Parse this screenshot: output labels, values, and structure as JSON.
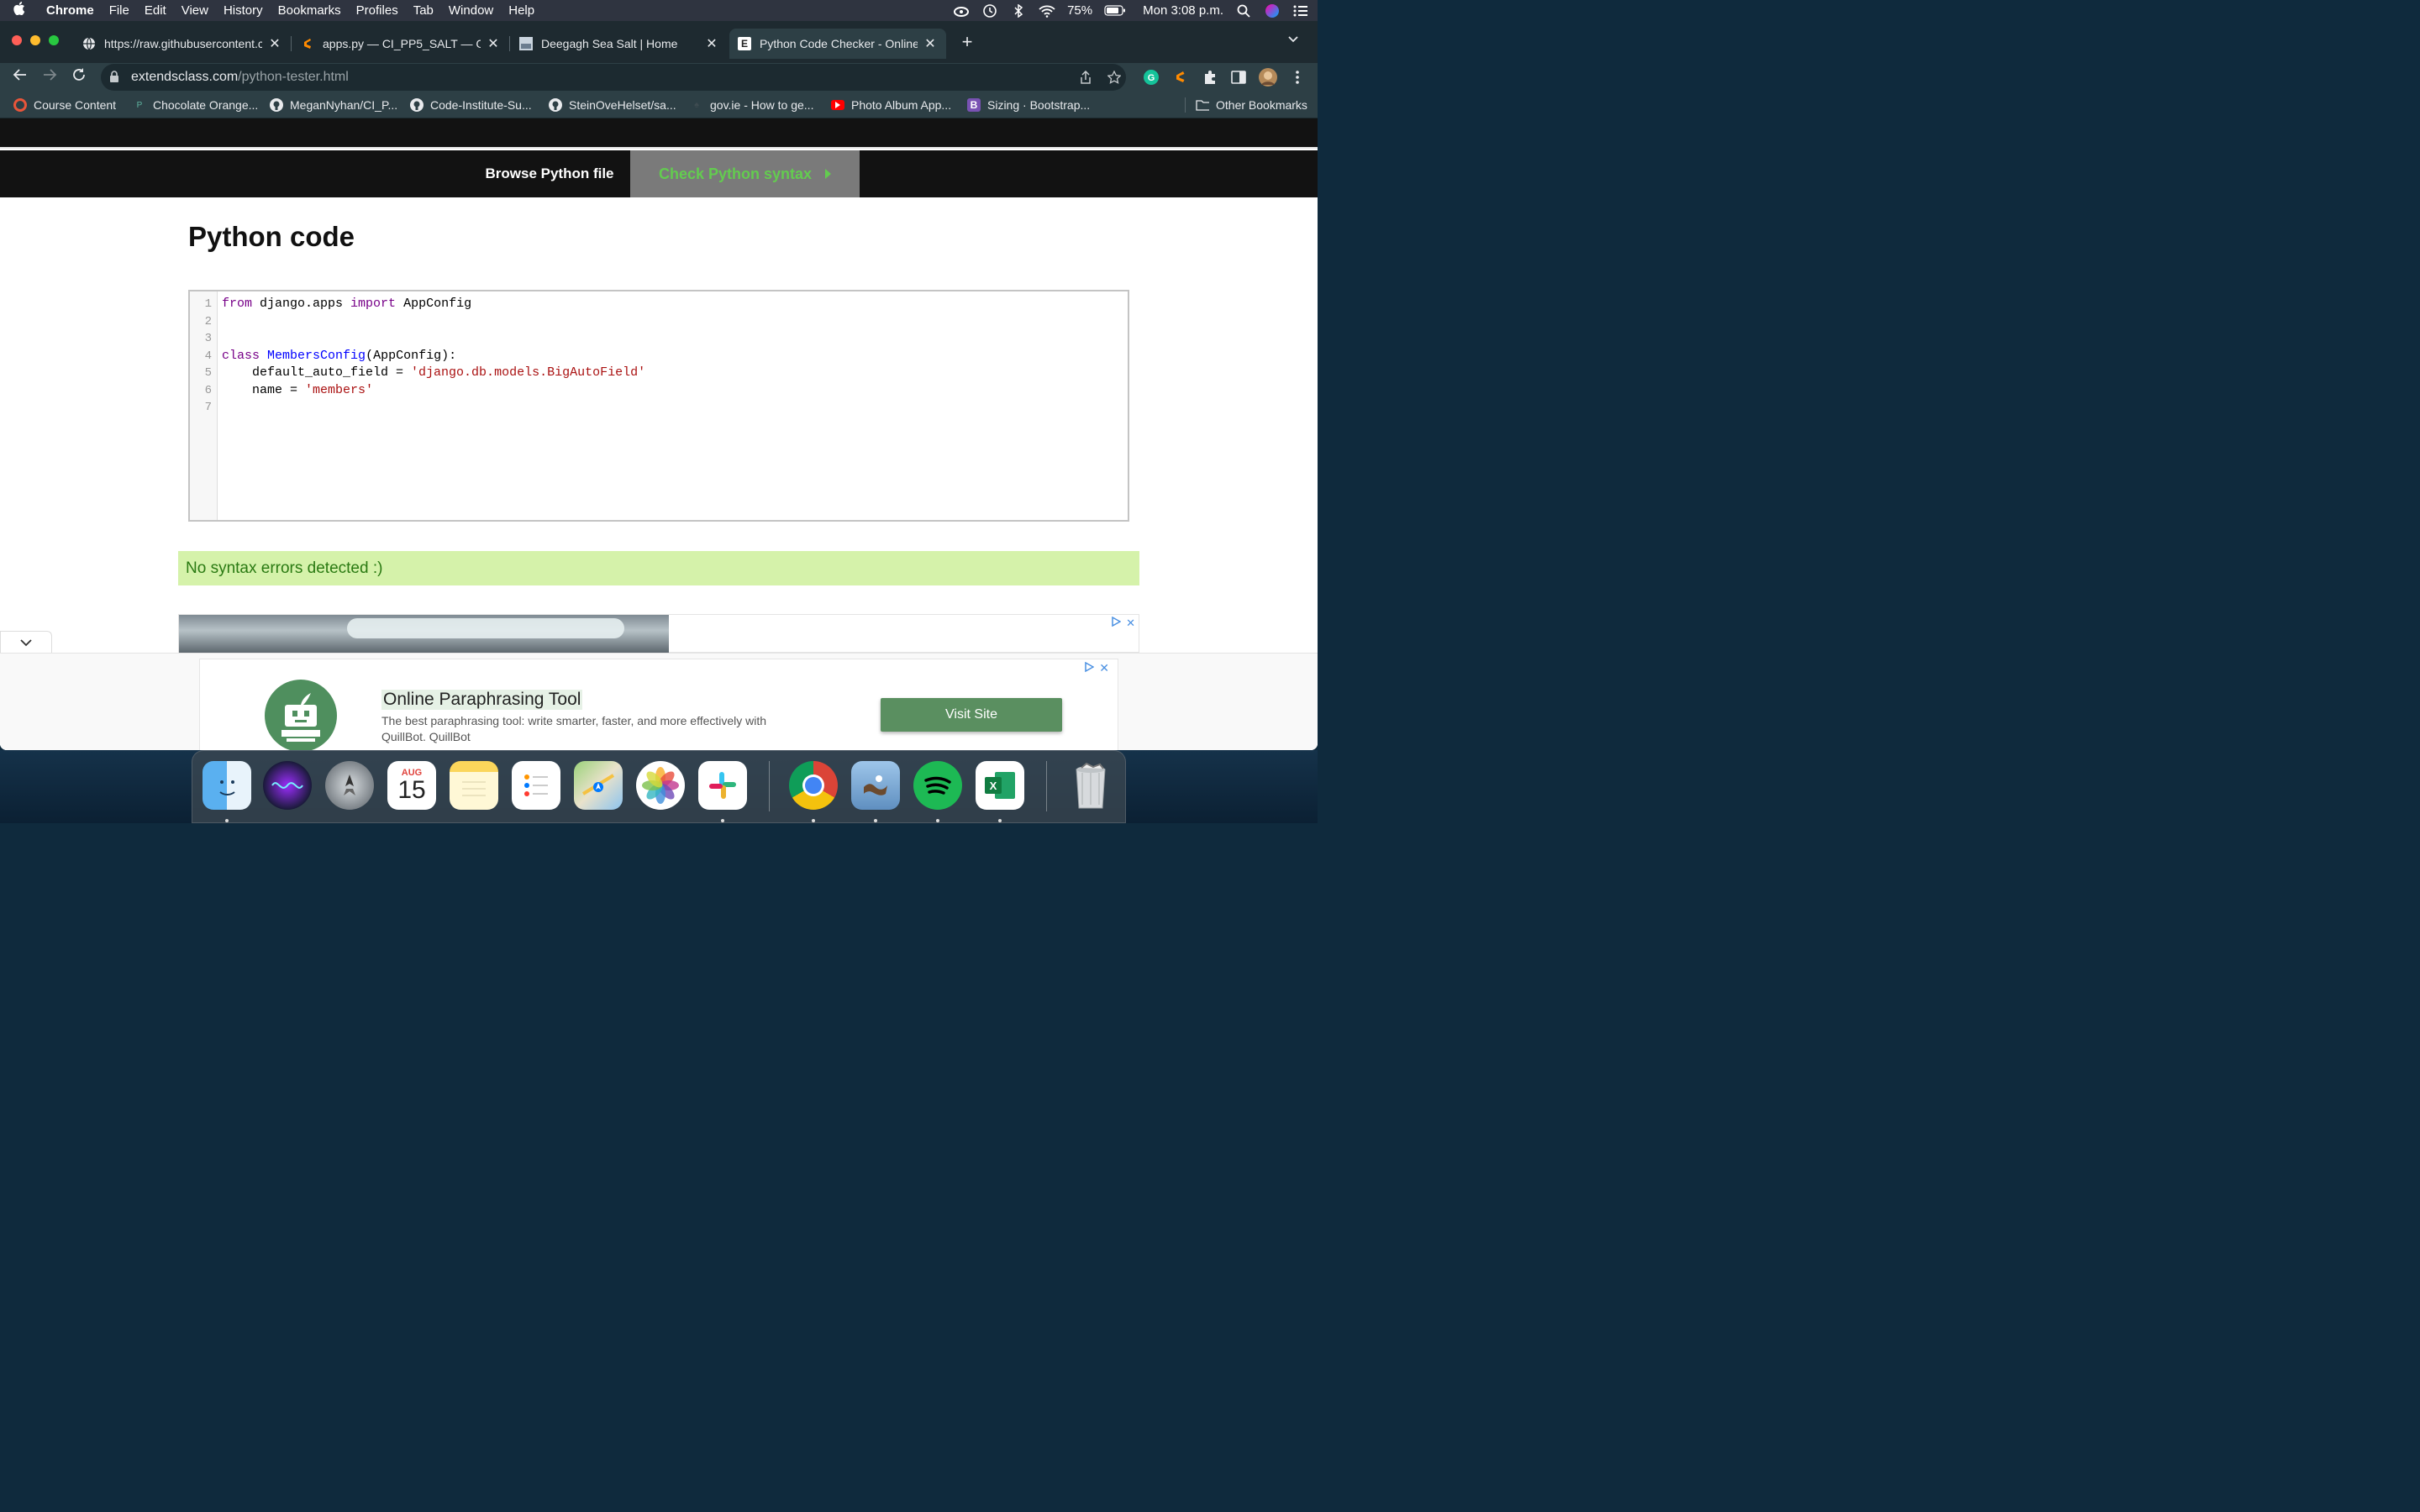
{
  "menubar": {
    "apple": "",
    "items": [
      "Chrome",
      "File",
      "Edit",
      "View",
      "History",
      "Bookmarks",
      "Profiles",
      "Tab",
      "Window",
      "Help"
    ],
    "battery": "75%",
    "clock": "Mon 3:08 p.m."
  },
  "tabs": [
    {
      "title": "https://raw.githubusercontent.c",
      "close": "✕"
    },
    {
      "title": "apps.py — CI_PP5_SALT — Git",
      "close": "✕"
    },
    {
      "title": "Deegagh Sea Salt | Home",
      "close": "✕"
    },
    {
      "title": "Python Code Checker - Online",
      "close": "✕",
      "favicon": "E"
    }
  ],
  "address": {
    "domain": "extendsclass.com",
    "path": "/python-tester.html"
  },
  "bookmarks": [
    "Course Content",
    "Chocolate Orange...",
    "MeganNyhan/CI_P...",
    "Code-Institute-Su...",
    "SteinOveHelset/sa...",
    "gov.ie - How to ge...",
    "Photo Album App...",
    "Sizing · Bootstrap..."
  ],
  "other_bookmarks": "Other Bookmarks",
  "site": {
    "browse_label": "Browse Python file",
    "check_label": "Check Python syntax",
    "heading": "Python code",
    "line_numbers": [
      "1",
      "2",
      "3",
      "4",
      "5",
      "6",
      "7"
    ],
    "code": {
      "l1_kw1": "from",
      "l1_mod": " django.apps ",
      "l1_kw2": "import",
      "l1_name": " AppConfig",
      "l4_kw": "class",
      "l4_def": "MembersConfig",
      "l4_rest": "(AppConfig):",
      "l5_var": "    default_auto_field = ",
      "l5_str": "'django.db.models.BigAutoField'",
      "l6_var": "    name = ",
      "l6_str": "'members'"
    },
    "success_message": "No syntax errors detected :)"
  },
  "ad": {
    "title": "Online Paraphrasing Tool",
    "description": "The best paraphrasing tool: write smarter, faster, and more effectively with QuillBot. QuillBot",
    "cta": "Visit Site",
    "close": "✕"
  },
  "dock": {
    "calendar_month": "AUG",
    "calendar_day": "15"
  }
}
